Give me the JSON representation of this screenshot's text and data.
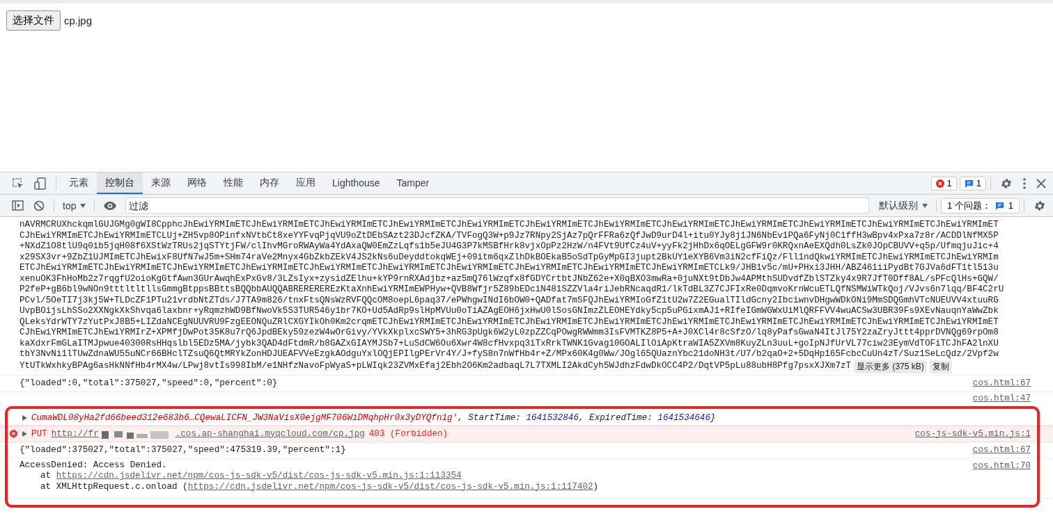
{
  "page": {
    "file_button": "选择文件",
    "file_name": "cp.jpg"
  },
  "devtools": {
    "tabs": [
      {
        "label": "元素",
        "selected": false
      },
      {
        "label": "控制台",
        "selected": true
      },
      {
        "label": "来源",
        "selected": false
      },
      {
        "label": "网络",
        "selected": false
      },
      {
        "label": "性能",
        "selected": false
      },
      {
        "label": "内存",
        "selected": false
      },
      {
        "label": "应用",
        "selected": false
      },
      {
        "label": "Lighthouse",
        "selected": false
      },
      {
        "label": "Tamper",
        "selected": false
      }
    ],
    "error_count": "1",
    "message_count": "1"
  },
  "console_toolbar": {
    "context": "top",
    "filter": {
      "placeholder": "过滤"
    },
    "level": "默认级别",
    "issues_label": "1 个问题：",
    "issues_count": "1"
  },
  "log": {
    "lines": [
      "nAVRMCRUXhckqmlGUJGMg0gWI8CpphcJhEwiYRMImETCJhEwiYRMImETCJhEwiYRMImETCJhEwiYRMImETCJhEwiYRMImETCJhEwiYRMImETCJhEwiYRMImETCJhEwiYRMImETCJhEwiYRMImETCJhEwiYRMImETCJhEwiYRMImETCJhEwiYRMImET",
      "CJhEwiYRMImETCJhEwiYRMImETCLUj+ZH5vp8OPinfxNVtbCt8xeYYFvqPjqVU9oZtDEbSAzt23DJcfZKA/TVFogQ3W+p9Jz7RNpy2SjAz7pQrFFRa6zQfJwD9urD4l+itu0YJy8j1JN6NbEv1PQa6FyNj0C1ffH3wBpv4xPxa7z8r/ACDDlNfMX5P",
      "+NXdZ1O8tlU9q0ib5jqH08f6XStWzTRUs2jqSTYtjFW/clIhvMGroRWAyWa4YdAxaQW0EmZzLqfs1b5eJU4G3P7kMSBfHrk8vjxOpPz2HzW/n4FVt9UfCz4uV+yyFk2jHhDx6qOELgGFW9r0KRQxnAeEXQdh0LsZk0JOpCBUVV+q5p/UfmqjuJic+4",
      "x29SX3vr+9ZbZ1UJMImETCJhEwixF8UfN7wJ5m+SHm74raVe2Mnyx4GbZkbZEkV4JS2kNs6uDeyddtokqWEj+09itm6qxZlhDkBOEkaB5oSdTpGyMpGI3jupt2BkUY1eXYB6Vm3iN2cfFiQz/Fll1ndQkwiYRMImETCJhEwiYRMImETCJhEwiYRMIm",
      "ETCJhEwiYRMImETCJhEwiYRMImETCJhEwiYRMImETCJhEwiYRMImETCJhEwiYRMImETCJhEwiYRMImETCJhEwiYRMImETCJhEwiYRMImETCJhEwiYRMImETCJhEwiYRMImETCLk9/JHB1v5c/mU+PHxi3JHH/ABZ461iiPydBt7GJVa6dFT1tl513u",
      "xenuOK3FhHoMb2z7rqgfU2oioKgGtfAwn3GUrAwqhExPxGv8/3LZsIyx+zysidZElhu+kYP9rnRXAdjbz+az5mQ76lWzqfx8fGDYCrtbtJNbZ62e+X0qBXO3mwRa+0juNXt9tDbJw4APMthSUDvdfZblSTZky4x9R7JfT0Dff8AL/sPFcQlHs+GQW/",
      "P2feP+gB6bl9wNOn9tttltltllsGmmgBtppsBBttsBQQbbAUQQABREREREREzKtaXnhEwiYRMImEWPHyw+QVB8Wfjr5Z89bEDciN481SZZVla4riJebRNcaqdR1/lkTdBL3Z7CJFIxRe0DqmvoKrnWcuETLQfNSMWiWTkQoj/VJvs6n7lqq/BF4C2rU",
      "PCvl/5OeTI7j3kj5W+TLDcZF1PTu21vrdbNtZTds/J7TA9m826/tnxFtsQNsWzRVFQQcOM8oepL6paq37/ePWhgwINdI6bOW0+QADfat7mSFQJhEwiYRMIoGfZ1tU2w7Z2EGualTIldGcny2IbciwnvDHgwWDkONi9MmSDQGmhVTcNUEUVV4xtuuRG",
      "UvpBOijsLhSSo2XXNgkXkShvqa6laxbnr+yRqmzhWD9BfNwoVk5S3TUR546y1br7KO+Ud5AdRp9slHpMVUu0oTiAZAgEOH6jxHwU0lSosGNImzZLEOHEYdky5cp5uPGixmAJ1+RIfeIGmWGWxUiMlQRFFVV4wuACSw3UBR39Fs9XEvNauqnYaWwZbk",
      "QLeksYdrWTY7zYutPxJ8B5+LIZdaNCEgNUUVRU9FzgEEONQuZRlCXGYIkOh0Km2crqmETCJhEwiYRMImETCJhEwiYRMImETCJhEwiYRMImETCJhEwiYRMImETCJhEwiYRMImETCJhEwiYRMImETCJhEwiYRMImETCJhEwiYRMImETCJhEwiYRMImET",
      "CJhEwiYRMImETCJhEwiYRMIrZ+XPMfjDwPot35K8u7rQ6JpdBEky59zezW4wOrGivy/YVkXkplxcSWY5+3hRG3pUgk6W2yL0zpZZCqPOwgRWWmm3IsFVMTKZ8P5+A+J0XCl4r8cSfzO/lq8yPafsGwaN4ItJl75Y2zaZryJttt4pprDVNQg69rpOm8",
      "kaXdxrFmGLaITMJpwue40300RsHHqslbl5EDz5MA/jybk3QAD4dFtdmR/b8GAZxGIAYMJSb7+LuSdCW6Ou6Xwr4W8cfHvxpq3iTxRrkTWNK1Gvag10GOALIlOiApKtraWIA5ZXVm8KuyZLn3uuL+goIpNJfUrVL77ciw23EymVdTOFiTCJhFA2lnXU",
      "tbY3NvNi1lTUwZdnaWU55uNCr66BHclTZsuQ6QtMRYkZonHDJUEAFVVeEzgkAOdguYxlOQjEPIlgPErVr4Y/J+fyS8n7nWfHb4r+Z/MPx60K4g0Ww/JOgl65QUaznYbc21doNH3t/U7/b2qaO+2+5DqHp165FcbcCuUn4zT/Suz1SeLcQdz/2Vpf2w",
      "YtUTkWxhkyBPAg6asHkNNfHb4rMX4w/LPwj8vtIs998IbM/e1NHfzNavoFpWyaS+pLWIqk23ZVMxEfaj2Ebh2O6Km2adbaqL7L7TXMLI2AkdCyh5WJdhzFdwDkOCC4P2/DqtVP5pLu88ubH8Pfg7psxXJXm7zT"
    ],
    "show_more": "显示更多 (375 kB)",
    "copy": "复制"
  },
  "messages": [
    {
      "kind": "text",
      "text": "{\"loaded\":0,\"total\":375027,\"speed\":0,\"percent\":0}",
      "source": "cos.html:67"
    },
    {
      "kind": "object",
      "expanded": false,
      "parts": [
        {
          "kind": "string",
          "text": "CumaWDL08yHa2fd66beed312e683b6…CQewaLICFN_JW3NaVisX0ejgMF706WiDMqhpHr0x3yDYQfn1g'"
        },
        {
          "kind": "plain",
          "text": ", StartTime: "
        },
        {
          "kind": "number",
          "text": "1641532846"
        },
        {
          "kind": "plain",
          "text": ", ExpiredTime: "
        },
        {
          "kind": "number",
          "text": "1641534646"
        },
        {
          "kind": "plain",
          "text": "}"
        }
      ],
      "source": "cos.html:47"
    },
    {
      "kind": "error",
      "expanded": false,
      "method": "PUT",
      "url_start": "http://fr",
      "url_end": ".cos.ap-shanghai.myqcloud.com/cp.jpg",
      "status": "403 (Forbidden)",
      "source": "cos-js-sdk-v5.min.js:1"
    },
    {
      "kind": "text",
      "text": "{\"loaded\":375027,\"total\":375027,\"speed\":475319.39,\"percent\":1}",
      "source": "cos.html:67"
    },
    {
      "kind": "stack",
      "text": "AccessDenied: Access Denied.",
      "frames": [
        {
          "prefix": "at ",
          "url": "https://cdn.jsdelivr.net/npm/cos-js-sdk-v5/dist/cos-js-sdk-v5.min.js:1:113354"
        },
        {
          "prefix": "at XMLHttpRequest.c.onload (",
          "url": "https://cdn.jsdelivr.net/npm/cos-js-sdk-v5/dist/cos-js-sdk-v5.min.js:1:117402",
          "suffix": ")"
        }
      ],
      "source": "cos.html:70"
    }
  ]
}
